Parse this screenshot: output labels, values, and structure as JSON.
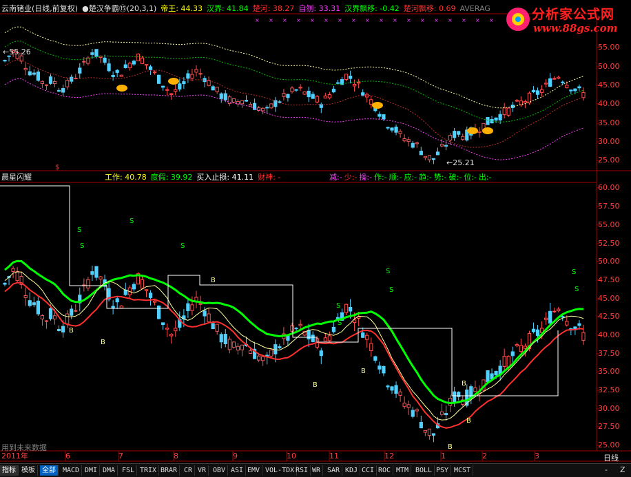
{
  "top_header": {
    "title": "云南锗业(日线,前复权)",
    "indicator": "●楚汉争霸⑮(20,3,1)",
    "items": [
      {
        "label": "帝王:",
        "value": "44.33",
        "color": "#ffff00"
      },
      {
        "label": "汉界:",
        "value": "41.84",
        "color": "#00ff00"
      },
      {
        "label": "楚河:",
        "value": "38.27",
        "color": "#ff3030"
      },
      {
        "label": "自刎:",
        "value": "33.31",
        "color": "#ff40ff"
      },
      {
        "label": "汉界飘移:",
        "value": "-0.42",
        "color": "#00ff00"
      },
      {
        "label": "楚河飘移:",
        "value": "0.69",
        "color": "#ff3030"
      },
      {
        "label": "AVERAG",
        "value": "",
        "color": "#808080"
      }
    ]
  },
  "logo": {
    "title": "分析家公式网",
    "url": "www.88gs.com"
  },
  "top_annotations": {
    "high": "55.26",
    "low": "25.21"
  },
  "top_axis": [
    "55.00",
    "50.00",
    "45.00",
    "40.00",
    "35.00",
    "30.00",
    "25.00"
  ],
  "mid_header": {
    "title": "晨星闪耀",
    "items": [
      {
        "label": "工作:",
        "value": "40.78",
        "color": "#ffff00"
      },
      {
        "label": "度假:",
        "value": "39.92",
        "color": "#00ff00"
      },
      {
        "label": "买入止损:",
        "value": "41.11",
        "color": "#ffffff"
      },
      {
        "label": "财神:",
        "value": "-",
        "color": "#ff3030"
      }
    ],
    "signals": [
      {
        "label": "减:",
        "value": "-",
        "color": "#ff40ff"
      },
      {
        "label": "少:",
        "value": "-",
        "color": "#ff3030"
      },
      {
        "label": "操:",
        "value": "-",
        "color": "#ff40ff"
      },
      {
        "label": "作:",
        "value": "-",
        "color": "#00ff00"
      },
      {
        "label": "顺:",
        "value": "-",
        "color": "#00ff00"
      },
      {
        "label": "应:",
        "value": "-",
        "color": "#00ff00"
      },
      {
        "label": "趋:",
        "value": "-",
        "color": "#00ff00"
      },
      {
        "label": "势:",
        "value": "-",
        "color": "#00ff00"
      },
      {
        "label": "破:",
        "value": "-",
        "color": "#00ff00"
      },
      {
        "label": "位:",
        "value": "-",
        "color": "#00ff00"
      },
      {
        "label": "出:",
        "value": "-",
        "color": "#00ff00"
      }
    ]
  },
  "mid_axis": [
    "60.00",
    "57.50",
    "55.00",
    "52.50",
    "50.00",
    "47.50",
    "45.00",
    "42.50",
    "40.00",
    "37.50",
    "35.00",
    "32.50",
    "30.00",
    "27.50",
    "25.00"
  ],
  "x_axis": [
    "2011年",
    "6",
    "7",
    "8",
    "9",
    "10",
    "11",
    "12",
    "1",
    "2",
    "3"
  ],
  "footer_note": "用到未来数据",
  "period": "日线",
  "nav": [
    "-",
    "Z"
  ],
  "tabs": [
    "指标",
    "模板",
    "全部",
    "MACD",
    "DMI",
    "DMA",
    "FSL",
    "TRIX",
    "BRAR",
    "CR",
    "VR",
    "OBV",
    "ASI",
    "EMV",
    "VOL-TDX",
    "RSI",
    "WR",
    "SAR",
    "KDJ",
    "CCI",
    "ROC",
    "MTM",
    "BOLL",
    "PSY",
    "MCST"
  ],
  "chart_data": {
    "type": "candlestick",
    "title": "云南锗业(日线,前复权)",
    "upper_ylim": [
      24,
      57
    ],
    "lower_ylim": [
      24,
      61
    ],
    "x_labels": [
      "2011年",
      "6",
      "7",
      "8",
      "9",
      "10",
      "11",
      "12",
      "1",
      "2",
      "3"
    ],
    "close_path": [
      47,
      49,
      48,
      45,
      44,
      42,
      43,
      41,
      42,
      44,
      46,
      49,
      48,
      46,
      44,
      45,
      47,
      48,
      46,
      44,
      42,
      40,
      41,
      43,
      45,
      44,
      42,
      40,
      39,
      38,
      39,
      38,
      37,
      36,
      38,
      39,
      40,
      41,
      40,
      39,
      38,
      40,
      42,
      44,
      43,
      41,
      39,
      37,
      34,
      33,
      31,
      30,
      29,
      27,
      26,
      28,
      30,
      32,
      31,
      32,
      33,
      34,
      35,
      36,
      37,
      38,
      39,
      40,
      41,
      43,
      44,
      42,
      41,
      40
    ],
    "series": [
      {
        "name": "帝王",
        "color": "#ffff00"
      },
      {
        "name": "汉界",
        "color": "#00ff00"
      },
      {
        "name": "楚河",
        "color": "#ff3030"
      },
      {
        "name": "自刎",
        "color": "#ff40ff"
      }
    ]
  }
}
